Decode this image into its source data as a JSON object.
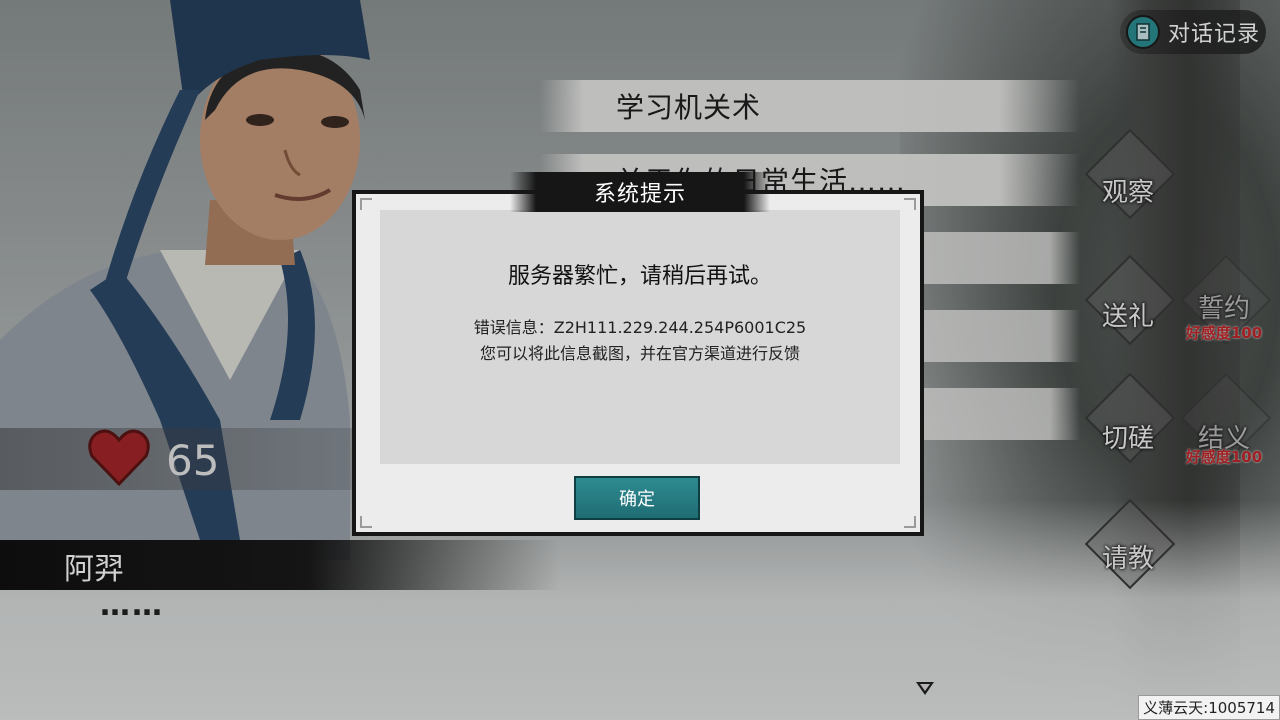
{
  "header": {
    "history_label": "对话记录"
  },
  "dialog_options": [
    {
      "label": "学习机关术"
    },
    {
      "label": "关于你的日常生活……"
    }
  ],
  "actions": [
    {
      "label": "观察"
    },
    {
      "label": "送礼"
    },
    {
      "label": "誓约",
      "favor_required": "好感度100"
    },
    {
      "label": "切磋"
    },
    {
      "label": "结义",
      "favor_required": "好感度100"
    },
    {
      "label": "请教"
    }
  ],
  "character": {
    "name": "阿羿",
    "favor_value": "65",
    "speech": "……"
  },
  "modal": {
    "title": "系统提示",
    "message": "服务器繁忙，请稍后再试。",
    "error_info": "错误信息：Z2H111.229.244.254P6001C25",
    "hint": "您可以将此信息截图，并在官方渠道进行反馈",
    "ok_label": "确定"
  },
  "footer": {
    "player_id": "义薄云天:1005714"
  },
  "colors": {
    "accent_teal": "#2e8b91",
    "favor_red": "#c4262a"
  },
  "icons": {
    "history": "book-icon",
    "observe": "telescope-icon",
    "gift": "gift-icon",
    "oath": "oath-icon",
    "spar": "crossed-swords-icon",
    "sworn": "incense-icon",
    "ask": "hand-icon",
    "heart": "heart-icon",
    "next": "triangle-down-icon"
  }
}
